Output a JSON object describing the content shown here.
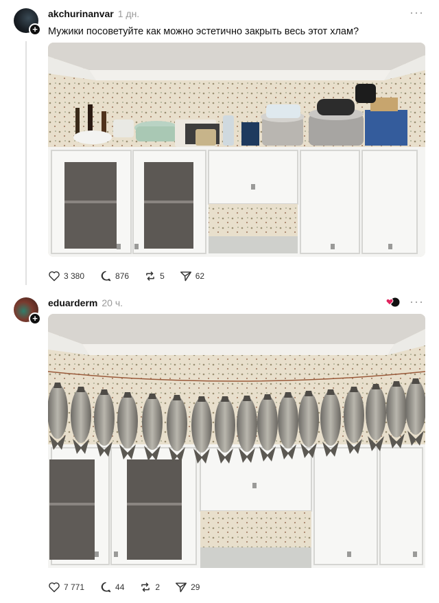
{
  "posts": [
    {
      "username": "akchurinanvar",
      "time": "1 дн.",
      "text": "Мужики посоветуйте как можно эстетично закрыть весь этот хлам?",
      "photo_icon": "kitchen-cabinets-clutter-photo",
      "stats": {
        "likes": "3 380",
        "comments": "876",
        "reposts": "5",
        "shares": "62"
      }
    },
    {
      "username": "eduarderm",
      "time": "20 ч.",
      "text": "",
      "photo_icon": "kitchen-cabinets-dried-fish-photo",
      "stats": {
        "likes": "7 771",
        "comments": "44",
        "reposts": "2",
        "shares": "29"
      }
    }
  ],
  "ui": {
    "more_glyph": "···",
    "plus_glyph": "+"
  },
  "colors": {
    "heart_badge": "#e0245e",
    "cabinet": "#f4f4f4",
    "wallpaper": "#e6dcc8",
    "ceiling": "#d9d6d2"
  }
}
